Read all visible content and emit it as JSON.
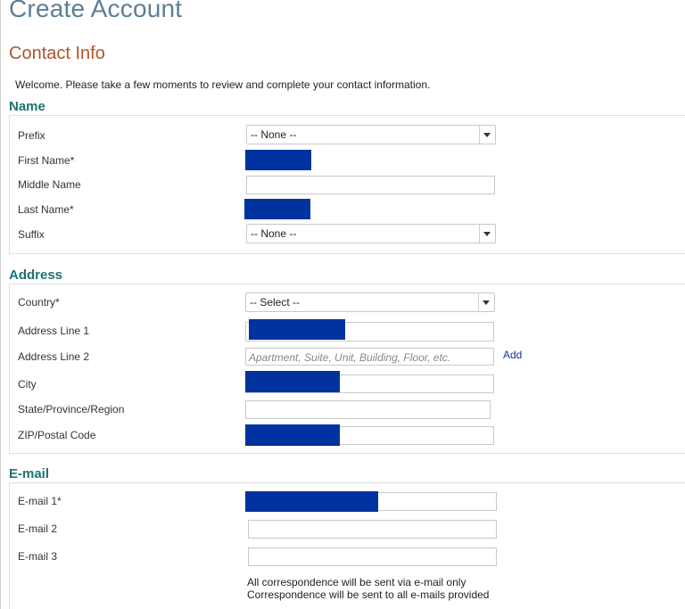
{
  "page": {
    "title": "Create Account",
    "subtitle": "Contact Info",
    "welcome": "Welcome. Please take a few moments to review and complete your contact information."
  },
  "name_section": {
    "title": "Name",
    "prefix": {
      "label": "Prefix",
      "value": "-- None --"
    },
    "first_name": {
      "label": "First Name*"
    },
    "middle_name": {
      "label": "Middle Name",
      "value": ""
    },
    "last_name": {
      "label": "Last Name*"
    },
    "suffix": {
      "label": "Suffix",
      "value": "-- None --"
    }
  },
  "address_section": {
    "title": "Address",
    "country": {
      "label": "Country*",
      "value": "-- Select --"
    },
    "address1": {
      "label": "Address Line 1"
    },
    "address2": {
      "label": "Address Line 2",
      "placeholder": "Apartment, Suite, Unit, Building, Floor, etc.",
      "add_label": "Add"
    },
    "city": {
      "label": "City"
    },
    "state": {
      "label": "State/Province/Region",
      "value": ""
    },
    "zip": {
      "label": "ZIP/Postal Code"
    }
  },
  "email_section": {
    "title": "E-mail",
    "email1": {
      "label": "E-mail 1*"
    },
    "email2": {
      "label": "E-mail 2",
      "value": ""
    },
    "email3": {
      "label": "E-mail 3",
      "value": ""
    },
    "notes": [
      "All correspondence will be sent via e-mail only",
      "Correspondence will be sent to all e-mails provided"
    ]
  },
  "colors": {
    "title": "#5b7f95",
    "subtitle": "#b0542a",
    "section_title": "#1f7273",
    "redaction": "#0033a0",
    "link": "#1a2f9c"
  }
}
